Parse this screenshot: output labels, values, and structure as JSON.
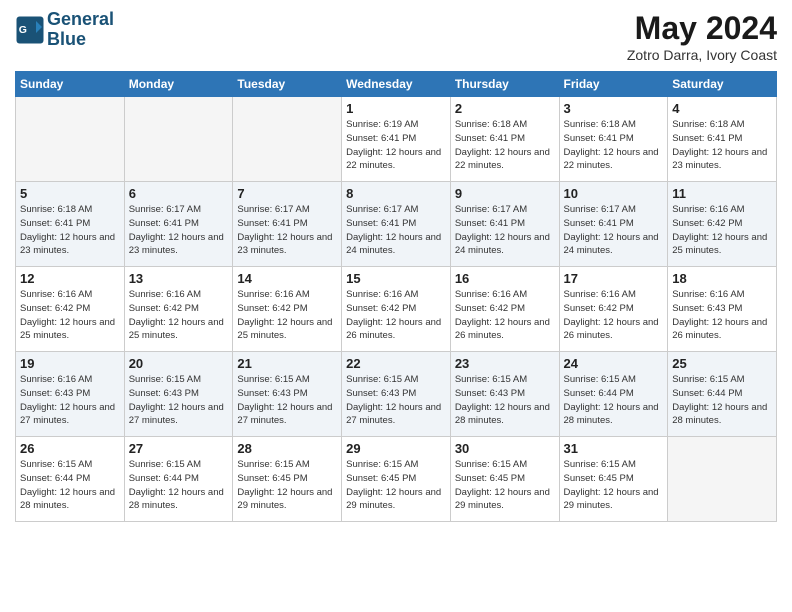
{
  "header": {
    "logo_line1": "General",
    "logo_line2": "Blue",
    "month": "May 2024",
    "location": "Zotro Darra, Ivory Coast"
  },
  "weekdays": [
    "Sunday",
    "Monday",
    "Tuesday",
    "Wednesday",
    "Thursday",
    "Friday",
    "Saturday"
  ],
  "weeks": [
    [
      {
        "day": "",
        "info": "",
        "empty": true
      },
      {
        "day": "",
        "info": "",
        "empty": true
      },
      {
        "day": "",
        "info": "",
        "empty": true
      },
      {
        "day": "1",
        "info": "Sunrise: 6:19 AM\nSunset: 6:41 PM\nDaylight: 12 hours\nand 22 minutes."
      },
      {
        "day": "2",
        "info": "Sunrise: 6:18 AM\nSunset: 6:41 PM\nDaylight: 12 hours\nand 22 minutes."
      },
      {
        "day": "3",
        "info": "Sunrise: 6:18 AM\nSunset: 6:41 PM\nDaylight: 12 hours\nand 22 minutes."
      },
      {
        "day": "4",
        "info": "Sunrise: 6:18 AM\nSunset: 6:41 PM\nDaylight: 12 hours\nand 23 minutes."
      }
    ],
    [
      {
        "day": "5",
        "info": "Sunrise: 6:18 AM\nSunset: 6:41 PM\nDaylight: 12 hours\nand 23 minutes."
      },
      {
        "day": "6",
        "info": "Sunrise: 6:17 AM\nSunset: 6:41 PM\nDaylight: 12 hours\nand 23 minutes."
      },
      {
        "day": "7",
        "info": "Sunrise: 6:17 AM\nSunset: 6:41 PM\nDaylight: 12 hours\nand 23 minutes."
      },
      {
        "day": "8",
        "info": "Sunrise: 6:17 AM\nSunset: 6:41 PM\nDaylight: 12 hours\nand 24 minutes."
      },
      {
        "day": "9",
        "info": "Sunrise: 6:17 AM\nSunset: 6:41 PM\nDaylight: 12 hours\nand 24 minutes."
      },
      {
        "day": "10",
        "info": "Sunrise: 6:17 AM\nSunset: 6:41 PM\nDaylight: 12 hours\nand 24 minutes."
      },
      {
        "day": "11",
        "info": "Sunrise: 6:16 AM\nSunset: 6:42 PM\nDaylight: 12 hours\nand 25 minutes."
      }
    ],
    [
      {
        "day": "12",
        "info": "Sunrise: 6:16 AM\nSunset: 6:42 PM\nDaylight: 12 hours\nand 25 minutes."
      },
      {
        "day": "13",
        "info": "Sunrise: 6:16 AM\nSunset: 6:42 PM\nDaylight: 12 hours\nand 25 minutes."
      },
      {
        "day": "14",
        "info": "Sunrise: 6:16 AM\nSunset: 6:42 PM\nDaylight: 12 hours\nand 25 minutes."
      },
      {
        "day": "15",
        "info": "Sunrise: 6:16 AM\nSunset: 6:42 PM\nDaylight: 12 hours\nand 26 minutes."
      },
      {
        "day": "16",
        "info": "Sunrise: 6:16 AM\nSunset: 6:42 PM\nDaylight: 12 hours\nand 26 minutes."
      },
      {
        "day": "17",
        "info": "Sunrise: 6:16 AM\nSunset: 6:42 PM\nDaylight: 12 hours\nand 26 minutes."
      },
      {
        "day": "18",
        "info": "Sunrise: 6:16 AM\nSunset: 6:43 PM\nDaylight: 12 hours\nand 26 minutes."
      }
    ],
    [
      {
        "day": "19",
        "info": "Sunrise: 6:16 AM\nSunset: 6:43 PM\nDaylight: 12 hours\nand 27 minutes."
      },
      {
        "day": "20",
        "info": "Sunrise: 6:15 AM\nSunset: 6:43 PM\nDaylight: 12 hours\nand 27 minutes."
      },
      {
        "day": "21",
        "info": "Sunrise: 6:15 AM\nSunset: 6:43 PM\nDaylight: 12 hours\nand 27 minutes."
      },
      {
        "day": "22",
        "info": "Sunrise: 6:15 AM\nSunset: 6:43 PM\nDaylight: 12 hours\nand 27 minutes."
      },
      {
        "day": "23",
        "info": "Sunrise: 6:15 AM\nSunset: 6:43 PM\nDaylight: 12 hours\nand 28 minutes."
      },
      {
        "day": "24",
        "info": "Sunrise: 6:15 AM\nSunset: 6:44 PM\nDaylight: 12 hours\nand 28 minutes."
      },
      {
        "day": "25",
        "info": "Sunrise: 6:15 AM\nSunset: 6:44 PM\nDaylight: 12 hours\nand 28 minutes."
      }
    ],
    [
      {
        "day": "26",
        "info": "Sunrise: 6:15 AM\nSunset: 6:44 PM\nDaylight: 12 hours\nand 28 minutes."
      },
      {
        "day": "27",
        "info": "Sunrise: 6:15 AM\nSunset: 6:44 PM\nDaylight: 12 hours\nand 28 minutes."
      },
      {
        "day": "28",
        "info": "Sunrise: 6:15 AM\nSunset: 6:45 PM\nDaylight: 12 hours\nand 29 minutes."
      },
      {
        "day": "29",
        "info": "Sunrise: 6:15 AM\nSunset: 6:45 PM\nDaylight: 12 hours\nand 29 minutes."
      },
      {
        "day": "30",
        "info": "Sunrise: 6:15 AM\nSunset: 6:45 PM\nDaylight: 12 hours\nand 29 minutes."
      },
      {
        "day": "31",
        "info": "Sunrise: 6:15 AM\nSunset: 6:45 PM\nDaylight: 12 hours\nand 29 minutes."
      },
      {
        "day": "",
        "info": "",
        "empty": true
      }
    ]
  ]
}
